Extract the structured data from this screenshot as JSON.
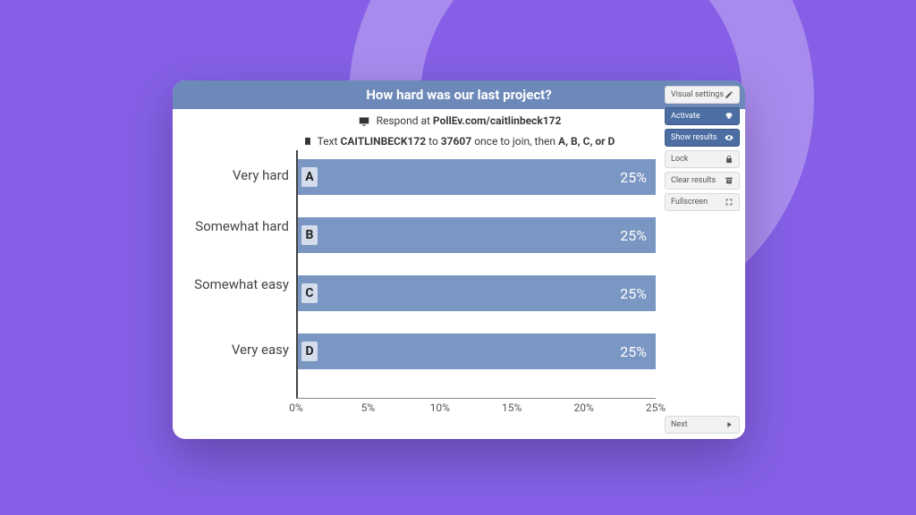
{
  "title": "How hard was our last project?",
  "instructions": {
    "respond_prefix": "Respond at ",
    "respond_url": "PollEv.com/caitlinbeck172",
    "text_prefix": "Text ",
    "text_code": "CAITLINBECK172",
    "text_mid": " to ",
    "text_number": "37607",
    "text_suffix1": " once to join, then ",
    "text_options": "A, B, C, or D"
  },
  "side_buttons": {
    "visual": "Visual settings",
    "activate": "Activate",
    "show": "Show results",
    "lock": "Lock",
    "clear": "Clear results",
    "full": "Fullscreen",
    "next": "Next"
  },
  "chart_data": {
    "type": "bar",
    "orientation": "horizontal",
    "title": "How hard was our last project?",
    "xlabel": "",
    "ylabel": "",
    "xlim": [
      0,
      25
    ],
    "xticks": [
      "0%",
      "5%",
      "10%",
      "15%",
      "20%",
      "25%"
    ],
    "categories": [
      "Very hard",
      "Somewhat hard",
      "Somewhat easy",
      "Very easy"
    ],
    "letters": [
      "A",
      "B",
      "C",
      "D"
    ],
    "values": [
      25,
      25,
      25,
      25
    ],
    "value_labels": [
      "25%",
      "25%",
      "25%",
      "25%"
    ]
  }
}
